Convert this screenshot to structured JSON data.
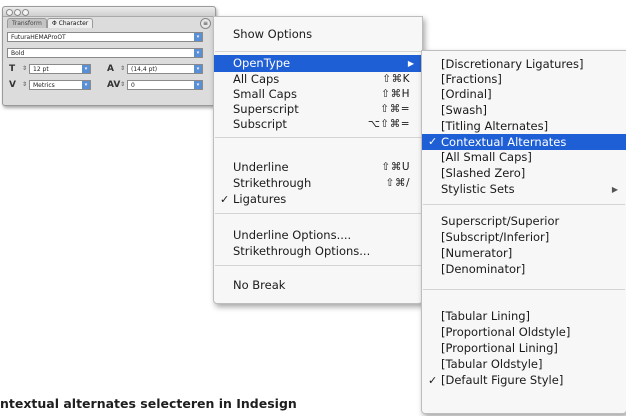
{
  "panel": {
    "tabs": [
      "Transform",
      "Character"
    ],
    "tab_prefix": "Φ",
    "font_family": "FuturaHEMAProOT",
    "font_style": "Bold",
    "font_size": "12 pt",
    "leading": "(14,4 pt)",
    "kerning": "Metrics",
    "tracking": "0"
  },
  "main_menu": {
    "items": [
      {
        "label": "Show Options"
      },
      {
        "label": "OpenType",
        "submenu": true,
        "highlighted": true
      },
      {
        "label": "All Caps",
        "shortcut": "⇧⌘K"
      },
      {
        "label": "Small Caps",
        "shortcut": "⇧⌘H"
      },
      {
        "label": "Superscript",
        "shortcut": "⇧⌘="
      },
      {
        "label": "Subscript",
        "shortcut": "⌥⇧⌘="
      },
      {
        "label": "Underline",
        "shortcut": "⇧⌘U"
      },
      {
        "label": "Strikethrough",
        "shortcut": "⇧⌘/"
      },
      {
        "label": "Ligatures",
        "checked": true
      },
      {
        "label": "Underline Options...."
      },
      {
        "label": "Strikethrough Options..."
      },
      {
        "label": "No Break"
      }
    ]
  },
  "opentype_menu": {
    "items": [
      {
        "label": "[Discretionary Ligatures]"
      },
      {
        "label": "[Fractions]"
      },
      {
        "label": "[Ordinal]"
      },
      {
        "label": "[Swash]"
      },
      {
        "label": "[Titling Alternates]"
      },
      {
        "label": "Contextual Alternates",
        "checked": true,
        "highlighted": true
      },
      {
        "label": "[All Small Caps]"
      },
      {
        "label": "[Slashed Zero]"
      },
      {
        "label": "Stylistic Sets",
        "submenu": true
      },
      {
        "label": "Superscript/Superior"
      },
      {
        "label": "[Subscript/Inferior]"
      },
      {
        "label": "[Numerator]"
      },
      {
        "label": "[Denominator]"
      },
      {
        "label": "[Tabular Lining]"
      },
      {
        "label": "[Proportional Oldstyle]"
      },
      {
        "label": "[Proportional Lining]"
      },
      {
        "label": "[Tabular Oldstyle]"
      },
      {
        "label": "[Default Figure Style]",
        "checked": true
      }
    ]
  },
  "symbols": {
    "check": "✓",
    "submenu_arrow": "▶",
    "panel_menu": "≡",
    "dropdown": "▾",
    "spinner": "⇕"
  },
  "caption": "ntextual alternates selecteren in Indesign",
  "colors": {
    "highlight": "#1f5fd6",
    "menu_bg": "#f7f7f7",
    "panel_bg": "#dcdcdc"
  }
}
